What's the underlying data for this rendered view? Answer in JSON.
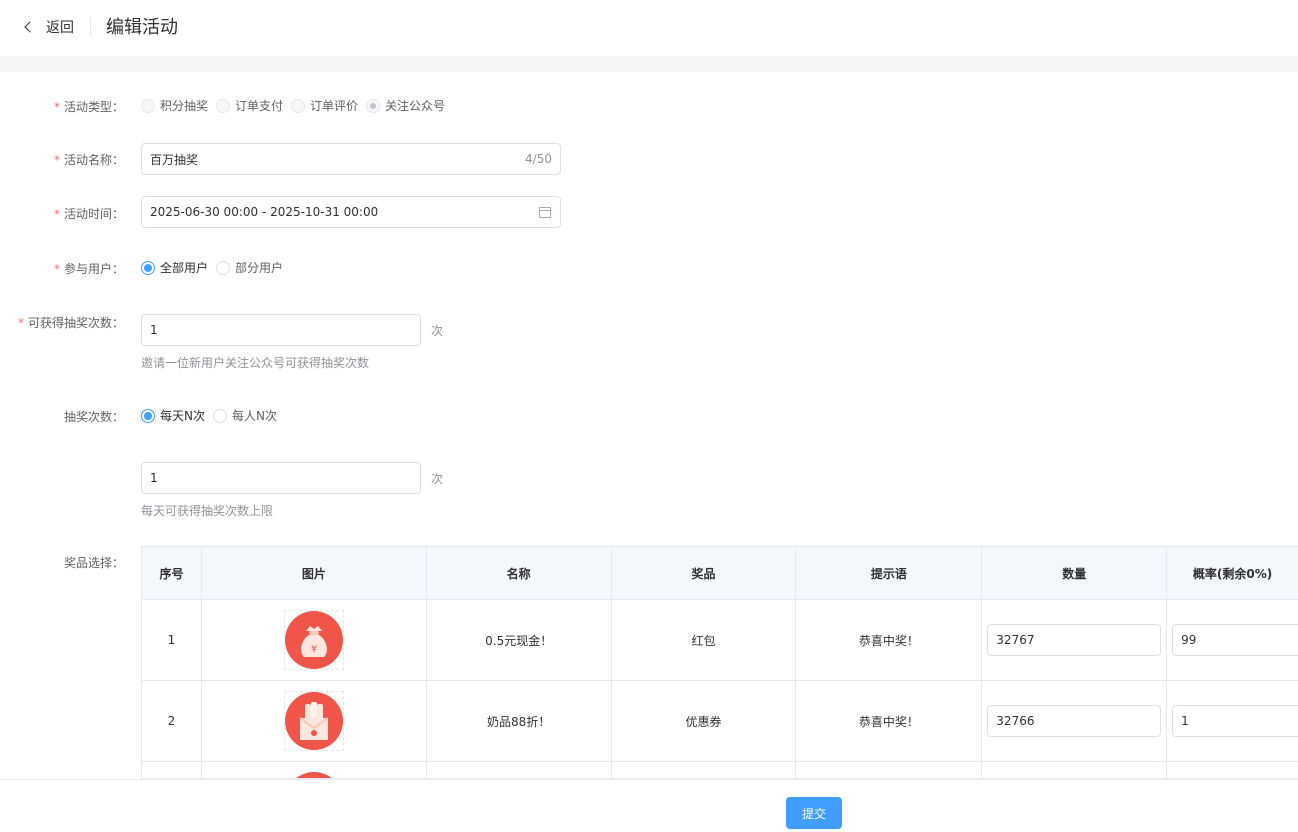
{
  "header": {
    "back_label": "返回",
    "title": "编辑活动"
  },
  "form": {
    "type": {
      "label": "活动类型：",
      "options": [
        "积分抽奖",
        "订单支付",
        "订单评价",
        "关注公众号"
      ]
    },
    "name": {
      "label": "活动名称：",
      "value": "百万抽奖",
      "count": "4/50"
    },
    "time": {
      "label": "活动时间：",
      "value": "2025-06-30 00:00 - 2025-10-31 00:00"
    },
    "users": {
      "label": "参与用户：",
      "options": [
        "全部用户",
        "部分用户"
      ]
    },
    "draws": {
      "label": "可获得抽奖次数：",
      "value": "1",
      "unit": "次",
      "hint": "邀请一位新用户关注公众号可获得抽奖次数"
    },
    "times": {
      "label": "抽奖次数：",
      "options": [
        "每天N次",
        "每人N次"
      ],
      "value": "1",
      "unit": "次",
      "hint": "每天可获得抽奖次数上限"
    },
    "prizes_label": "奖品选择："
  },
  "table": {
    "headers": [
      "序号",
      "图片",
      "名称",
      "奖品",
      "提示语",
      "数量",
      "概率(剩余0%)"
    ],
    "rows": [
      {
        "no": "1",
        "name": "0.5元现金！",
        "prize": "红包",
        "tip": "恭喜中奖！",
        "qty": "32767",
        "rate": "99"
      },
      {
        "no": "2",
        "name": "奶品88折！",
        "prize": "优惠券",
        "tip": "恭喜中奖！",
        "qty": "32766",
        "rate": "1"
      }
    ]
  },
  "footer": {
    "submit_label": "提交"
  },
  "colors": {
    "primary": "#409eff",
    "required": "#f56c6c",
    "prize_red": "#f0554a"
  }
}
